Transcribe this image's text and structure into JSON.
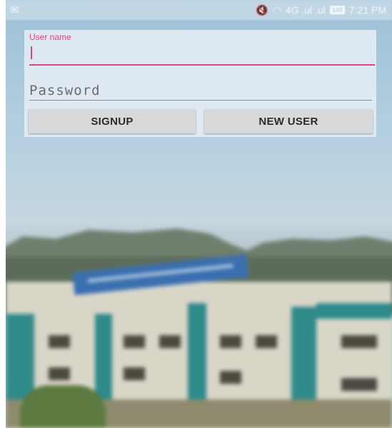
{
  "status_bar": {
    "time": "7:21 PM",
    "battery": "100",
    "signal_text": "4G .ul  .ul"
  },
  "login": {
    "username_label": "User name",
    "username_value": "",
    "password_placeholder": "Password",
    "signup_button": "SIGNUP",
    "new_user_button": "NEW USER"
  },
  "colors": {
    "accent": "#e0437f",
    "button_bg": "#d7d9db"
  },
  "icons": [
    "app-notification-icon",
    "mute-icon",
    "wifi-icon",
    "signal-icon",
    "battery-icon"
  ]
}
